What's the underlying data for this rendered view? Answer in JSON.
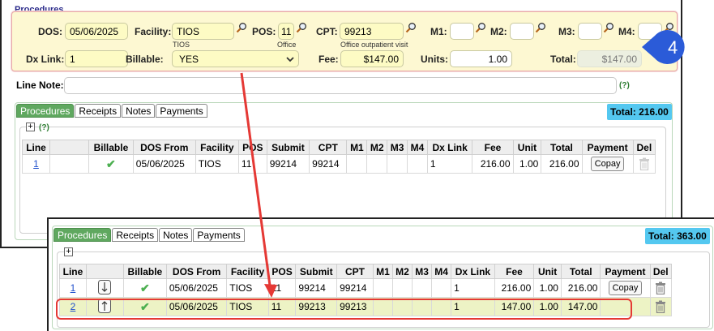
{
  "procedures_title": "Procedures",
  "form": {
    "dos_label": "DOS:",
    "dos_value": "05/06/2025",
    "facility_label": "Facility:",
    "facility_value": "TIOS",
    "facility_sub": "TIOS",
    "pos_label": "POS:",
    "pos_value": "11",
    "pos_sub": "Office",
    "cpt_label": "CPT:",
    "cpt_value": "99213",
    "cpt_sub": "Office outpatient visit",
    "m1_label": "M1:",
    "m2_label": "M2:",
    "m3_label": "M3:",
    "m4_label": "M4:",
    "dxlink_label": "Dx Link:",
    "dxlink_value": "1",
    "billable_label": "Billable:",
    "billable_value": "YES",
    "fee_label": "Fee:",
    "fee_value": "$147.00",
    "units_label": "Units:",
    "units_value": "1.00",
    "total_label": "Total:",
    "total_value": "$147.00"
  },
  "line_note_label": "Line Note:",
  "help_text": "(?)",
  "step_badge": "4",
  "tabs": [
    "Procedures",
    "Receipts",
    "Notes",
    "Payments"
  ],
  "columns": [
    "Line",
    "",
    "Billable",
    "DOS From",
    "Facility",
    "POS",
    "Submit",
    "CPT",
    "M1",
    "M2",
    "M3",
    "M4",
    "Dx Link",
    "Fee",
    "Unit",
    "Total",
    "Payment",
    "Del"
  ],
  "copay_label": "Copay",
  "before": {
    "total": "Total: 216.00",
    "rows": [
      {
        "line": "1",
        "dos": "05/06/2025",
        "facility": "TIOS",
        "pos": "11",
        "submit": "99214",
        "cpt": "99214",
        "dx": "1",
        "fee": "216.00",
        "unit": "1.00",
        "total": "216.00"
      }
    ]
  },
  "after": {
    "total": "Total: 363.00",
    "rows": [
      {
        "line": "1",
        "dos": "05/06/2025",
        "facility": "TIOS",
        "pos": "11",
        "submit": "99214",
        "cpt": "99214",
        "dx": "1",
        "fee": "216.00",
        "unit": "1.00",
        "total": "216.00"
      },
      {
        "line": "2",
        "dos": "05/06/2025",
        "facility": "TIOS",
        "pos": "11",
        "submit": "99213",
        "cpt": "99213",
        "dx": "1",
        "fee": "147.00",
        "unit": "1.00",
        "total": "147.00"
      }
    ]
  },
  "colors": {
    "accent_green": "#5fa85f",
    "total_blue": "#54c8f0",
    "highlight_red": "#e53935",
    "badge_blue": "#2b5bd8"
  }
}
